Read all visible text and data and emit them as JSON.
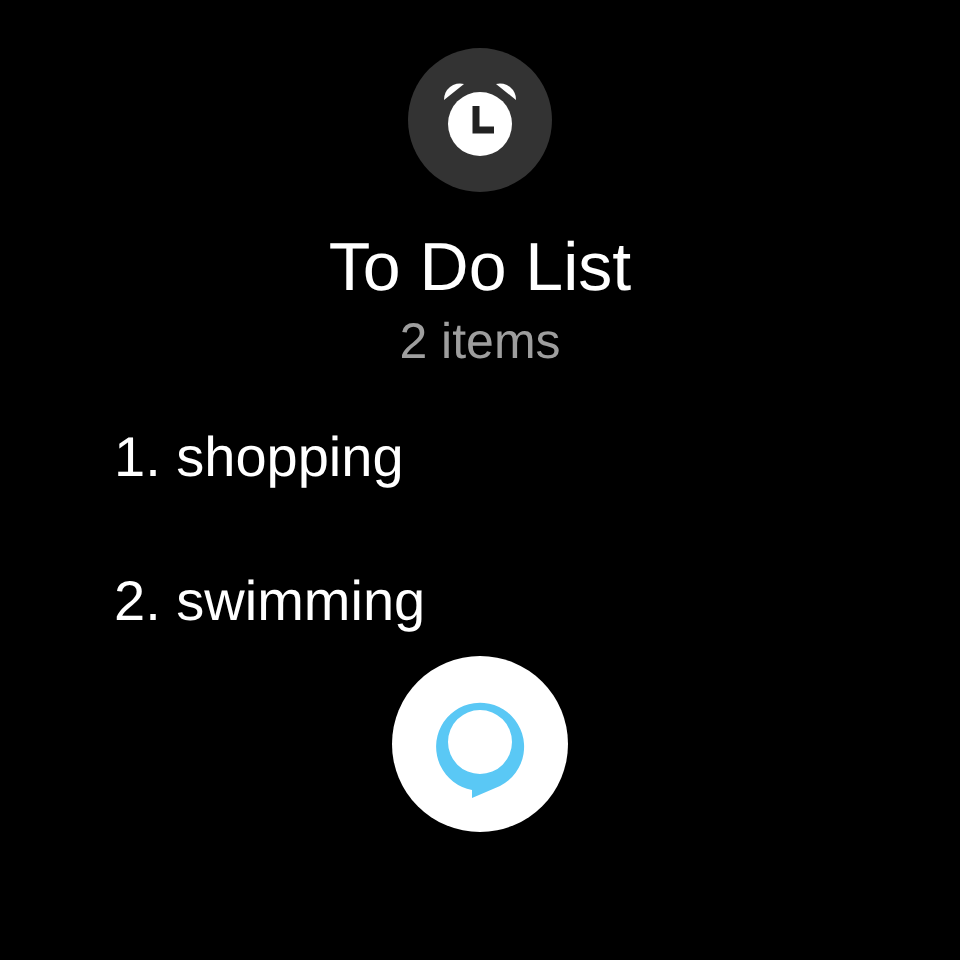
{
  "header": {
    "title": "To Do List",
    "subtitle": "2 items"
  },
  "items": [
    {
      "text": "1. shopping"
    },
    {
      "text": "2. swimming"
    }
  ]
}
